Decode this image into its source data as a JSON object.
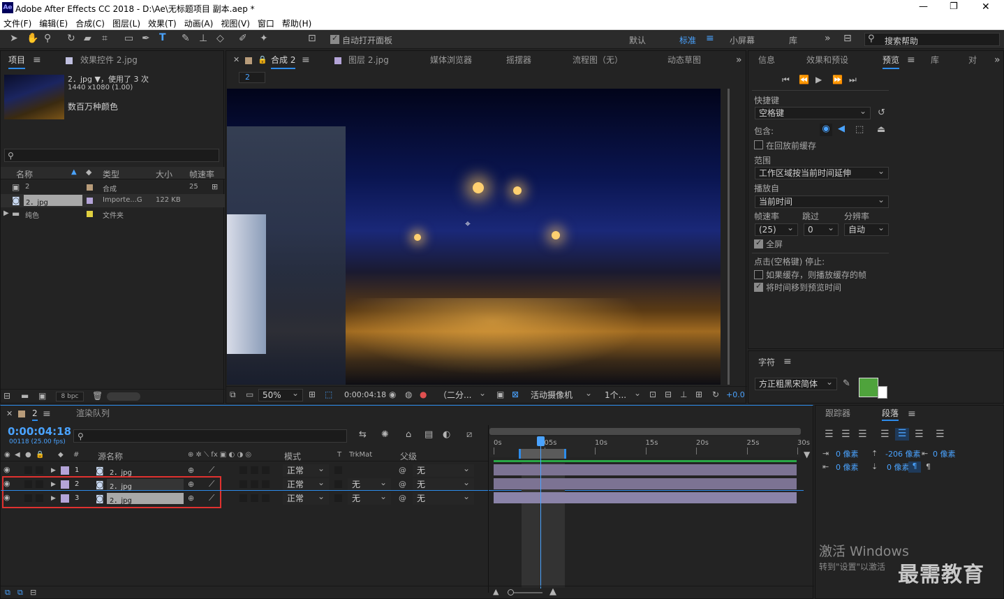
{
  "app": {
    "title": "Adobe After Effects CC 2018 - D:\\Ae\\无标题项目 副本.aep *",
    "icon": "Ae"
  },
  "window_controls": {
    "min": "—",
    "max": "❐",
    "close": "✕"
  },
  "menu": [
    "文件(F)",
    "编辑(E)",
    "合成(C)",
    "图层(L)",
    "效果(T)",
    "动画(A)",
    "视图(V)",
    "窗口",
    "帮助(H)"
  ],
  "toolbar": {
    "auto_open": "自动打开面板",
    "workspaces": [
      "默认",
      "标准",
      "小屏幕",
      "库"
    ],
    "search_placeholder": "搜索帮助"
  },
  "project": {
    "tabs": [
      "项目",
      "效果控件 2.jpg"
    ],
    "item_name": "2．jpg ▼，使用了 3 次",
    "item_dims": "1440 x1080 (1.00)",
    "item_colors": "数百万种颜色",
    "headers": [
      "名称",
      "类型",
      "大小",
      "帧速率"
    ],
    "rows": [
      {
        "name": "2",
        "type": "合成",
        "size": "",
        "fps": "25"
      },
      {
        "name": "2．jpg",
        "type": "Importe...G",
        "size": "122 KB",
        "fps": ""
      },
      {
        "name": "纯色",
        "type": "文件夹",
        "size": "",
        "fps": ""
      }
    ],
    "bpc": "8 bpc"
  },
  "comp": {
    "tabs": [
      "合成 2",
      "图层 2.jpg",
      "媒体浏览器",
      "摇摆器",
      "流程图（无）",
      "动态草图"
    ],
    "sub_tab": "2",
    "zoom": "50%",
    "timecode": "0:00:04:18",
    "resolution": "（二分...",
    "camera": "活动摄像机",
    "views": "1个...",
    "exposure": "+0.0"
  },
  "preview": {
    "tabs": [
      "信息",
      "效果和预设",
      "预览",
      "库",
      "对"
    ],
    "shortcut_label": "快捷键",
    "shortcut_value": "空格键",
    "include_label": "包含:",
    "cache_before": "在回放前缓存",
    "range_label": "范围",
    "range_value": "工作区域按当前时间延伸",
    "play_from_label": "播放自",
    "play_from_value": "当前时间",
    "fps_label": "帧速率",
    "skip_label": "跳过",
    "res_label": "分辨率",
    "fps_value": "(25)",
    "skip_value": "0",
    "res_value": "自动",
    "fullscreen": "全屏",
    "stop_label": "点击(空格键) 停止:",
    "if_cached": "如果缓存，则播放缓存的帧",
    "move_time": "将时间移到预览时间"
  },
  "character": {
    "title": "字符",
    "font": "方正粗黑宋简体",
    "fill_color": "#4fa33c"
  },
  "timeline": {
    "tabs": [
      "2",
      "渲染队列"
    ],
    "timecode": "0:00:04:18",
    "frame_info": "00118 (25.00 fps)",
    "headers": {
      "num": "#",
      "source": "源名称",
      "mode": "模式",
      "t": "T",
      "trkmat": "TrkMat",
      "parent": "父级"
    },
    "layers": [
      {
        "num": "1",
        "name": "2．jpg",
        "mode": "正常",
        "trkmat": "",
        "parent": "无"
      },
      {
        "num": "2",
        "name": "2．jpg",
        "mode": "正常",
        "trkmat": "无",
        "parent": "无"
      },
      {
        "num": "3",
        "name": "2．jpg",
        "mode": "正常",
        "trkmat": "无",
        "parent": "无"
      }
    ],
    "ruler": [
      "0s",
      "05s",
      "10s",
      "15s",
      "20s",
      "25s",
      "30s"
    ]
  },
  "paragraph": {
    "tabs": [
      "跟踪器",
      "段落"
    ],
    "indent_left": "0 像素",
    "space_before": "-206 像素",
    "space_after": "0 像素",
    "indent_first": "0 像素",
    "indent_right": "0 像素"
  },
  "watermark": {
    "activate": "激活 Windows",
    "goto": "转到\"设置\"以激活",
    "brand": "最需教育"
  },
  "accent": "#2d8ceb",
  "highlight_box": "#e0312f"
}
